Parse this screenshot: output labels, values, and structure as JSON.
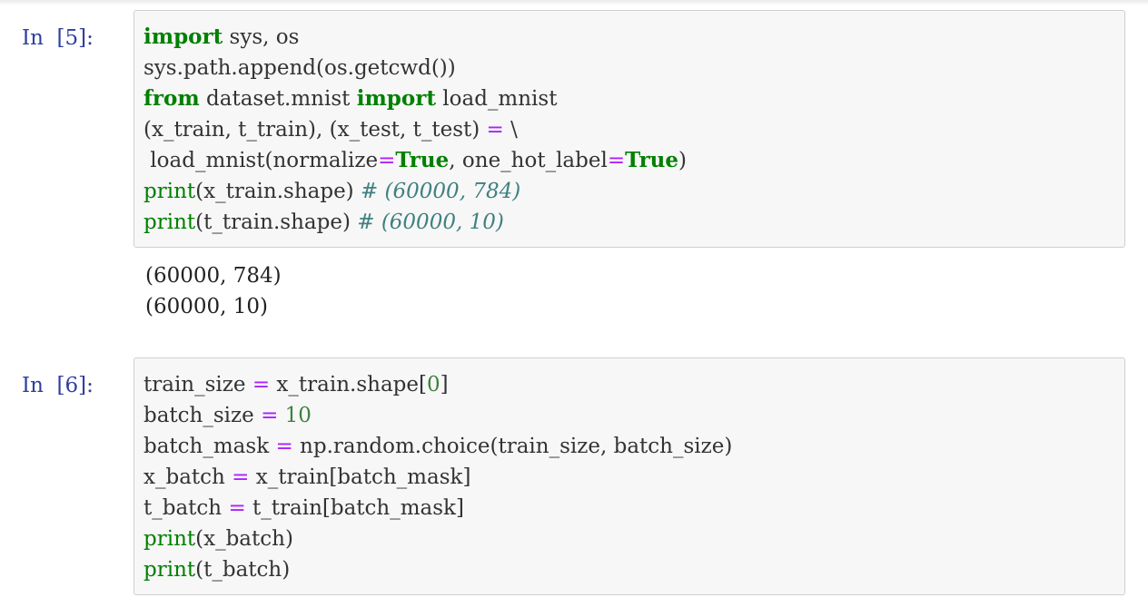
{
  "cells": [
    {
      "prompt": "In  [5]:",
      "lines": [
        {
          "kw1": "import",
          "t1": " sys, os"
        },
        {
          "t1": "sys.path.append(os.getcwd())"
        },
        {
          "kw1": "from",
          "t1": " dataset.mnist ",
          "kw2": "import",
          "t2": " load_mnist"
        },
        {
          "t1": "(x_train, t_train), (x_test, t_test) ",
          "op": "=",
          "t2": " \\"
        },
        {
          "t1": " load_mnist(normalize",
          "op1": "=",
          "kw1": "True",
          "t2": ", one_hot_label",
          "op2": "=",
          "kw2": "True",
          "t3": ")"
        },
        {
          "bi": "print",
          "t1": "(x_train.shape) ",
          "cm": "# (60000, 784)"
        },
        {
          "bi": "print",
          "t1": "(t_train.shape) ",
          "cm": "# (60000, 10)"
        }
      ],
      "output": [
        "(60000, 784)",
        "(60000, 10)"
      ]
    },
    {
      "prompt": "In  [6]:",
      "lines": [
        {
          "t1": "train_size ",
          "op": "=",
          "t2": " x_train.shape[",
          "num": "0",
          "t3": "]"
        },
        {
          "t1": "batch_size ",
          "op": "=",
          "t2": " ",
          "num": "10"
        },
        {
          "t1": "batch_mask ",
          "op": "=",
          "t2": " np.random.choice(train_size, batch_size)"
        },
        {
          "t1": "x_batch ",
          "op": "=",
          "t2": " x_train[batch_mask]"
        },
        {
          "t1": "t_batch ",
          "op": "=",
          "t2": " t_train[batch_mask]"
        },
        {
          "bi": "print",
          "t1": "(x_batch)"
        },
        {
          "bi": "print",
          "t1": "(t_batch)"
        }
      ]
    }
  ]
}
